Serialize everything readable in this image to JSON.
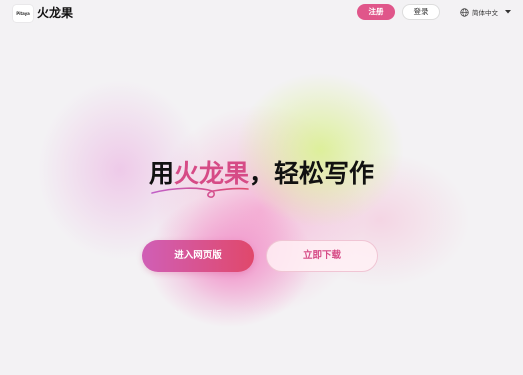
{
  "header": {
    "logo_badge_text": "Pitaya",
    "brand_name": "火龙果",
    "register_label": "注册",
    "login_label": "登录",
    "language_label": "简体中文",
    "language_icon": "globe-icon",
    "dropdown_icon": "caret-down-icon"
  },
  "hero": {
    "title_prefix": "用",
    "title_highlight": "火龙果",
    "title_suffix": "，轻松写作",
    "underline_icon": "swirl-underline-icon",
    "web_button_label": "进入网页版",
    "download_button_label": "立即下载"
  },
  "colors": {
    "accent": "#d64b86",
    "register_bg": "#e0568a",
    "web_button_start": "#d05fb6",
    "web_button_end": "#e0486b"
  }
}
